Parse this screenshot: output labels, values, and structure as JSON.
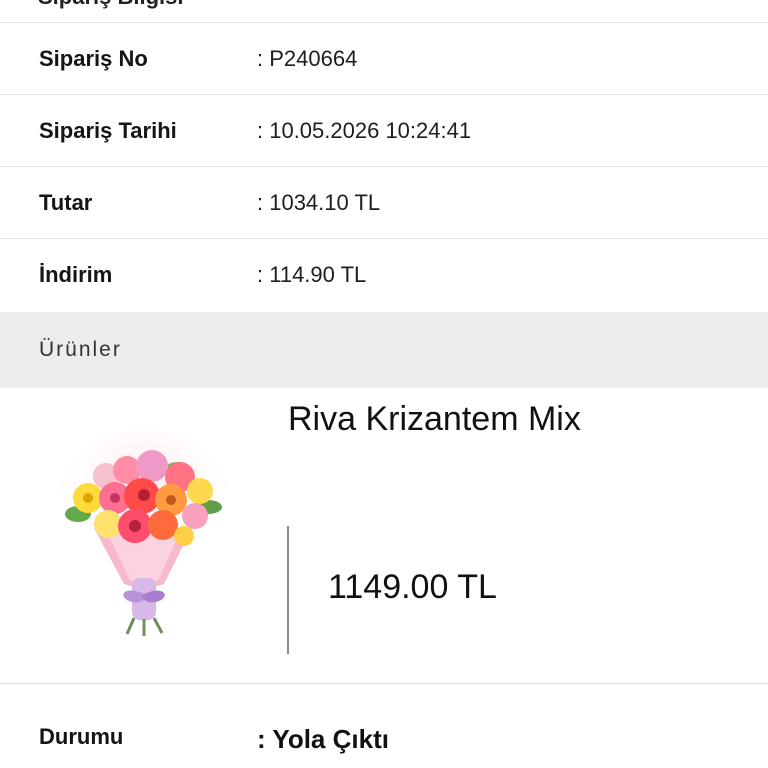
{
  "header": {
    "cut_title": "Sipariş Bilgisi"
  },
  "order": {
    "rows": [
      {
        "label": "Sipariş No",
        "value": ": P240664"
      },
      {
        "label": "Sipariş Tarihi",
        "value": ": 10.05.2026 10:24:41"
      },
      {
        "label": "Tutar",
        "value": ": 1034.10 TL"
      },
      {
        "label": "İndirim",
        "value": ": 114.90 TL"
      }
    ]
  },
  "products_section": {
    "title": "Ürünler"
  },
  "product": {
    "name": "Riva Krizantem Mix",
    "price": "1149.00 TL",
    "image_icon": "flower-bouquet-image"
  },
  "status": {
    "label": "Durumu",
    "value": ": Yola Çıktı"
  },
  "colors": {
    "section_background": "#ececec",
    "text": "#111111",
    "divider": "#e6e6e6"
  }
}
